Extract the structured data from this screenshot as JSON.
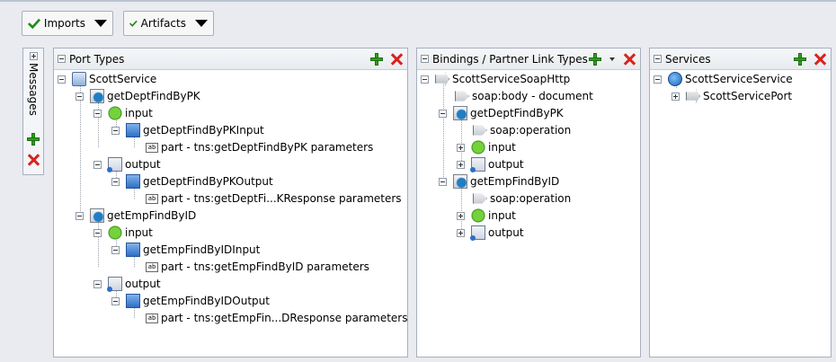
{
  "toolbar": {
    "imports_label": "Imports",
    "artifacts_label": "Artifacts"
  },
  "messages_panel": {
    "label": "Messages"
  },
  "port_types": {
    "title": "Port Types",
    "nodes": {
      "root": "ScottService",
      "op1": "getDeptFindByPK",
      "op1_input": "input",
      "op1_input_msg": "getDeptFindByPKInput",
      "op1_input_part": "part - tns:getDeptFindByPK parameters",
      "op1_output": "output",
      "op1_output_msg": "getDeptFindByPKOutput",
      "op1_output_part": "part - tns:getDeptFi...KResponse parameters",
      "op2": "getEmpFindByID",
      "op2_input": "input",
      "op2_input_msg": "getEmpFindByIDInput",
      "op2_input_part": "part - tns:getEmpFindByID parameters",
      "op2_output": "output",
      "op2_output_msg": "getEmpFindByIDOutput",
      "op2_output_part": "part - tns:getEmpFin...DResponse parameters"
    }
  },
  "bindings": {
    "title": "Bindings / Partner Link Types",
    "nodes": {
      "root": "ScottServiceSoapHttp",
      "soap_body": "soap:body - document",
      "op1": "getDeptFindByPK",
      "op1_soap": "soap:operation",
      "op1_input": "input",
      "op1_output": "output",
      "op2": "getEmpFindByID",
      "op2_soap": "soap:operation",
      "op2_input": "input",
      "op2_output": "output"
    }
  },
  "services": {
    "title": "Services",
    "nodes": {
      "root": "ScottServiceService",
      "port": "ScottServicePort"
    }
  },
  "colors": {
    "add": "#2f9e1f",
    "delete": "#d8231c",
    "background": "#e9ebf0"
  }
}
